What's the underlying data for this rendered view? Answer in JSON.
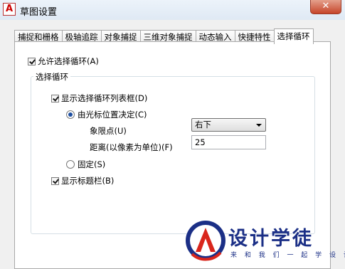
{
  "window": {
    "app_icon_letter": "A",
    "title": "草图设置",
    "close_label": "✕"
  },
  "tabs": [
    {
      "label": "捕捉和栅格",
      "active": false
    },
    {
      "label": "极轴追踪",
      "active": false
    },
    {
      "label": "对象捕捉",
      "active": false
    },
    {
      "label": "三维对象捕捉",
      "active": false
    },
    {
      "label": "动态输入",
      "active": false
    },
    {
      "label": "快捷特性",
      "active": false
    },
    {
      "label": "选择循环",
      "active": true
    }
  ],
  "panel": {
    "allow_selection_cycling": {
      "label": "允许选择循环(A)",
      "checked": true
    },
    "group_title": "选择循环",
    "show_list_box": {
      "label": "显示选择循环列表框(D)",
      "checked": true
    },
    "cursor_position": {
      "label": "由光标位置决定(C)",
      "selected": true
    },
    "quadrant": {
      "label": "象限点(U)",
      "value": "右下"
    },
    "distance": {
      "label": "距离(以像素为单位)(F)",
      "value": "25"
    },
    "fixed": {
      "label": "固定(S)",
      "selected": false
    },
    "show_title_bar": {
      "label": "显示标题栏(B)",
      "checked": true
    }
  },
  "watermark": {
    "title": "设计学徒",
    "subtitle": "来 和 我 们 一 起 学 设 计"
  }
}
